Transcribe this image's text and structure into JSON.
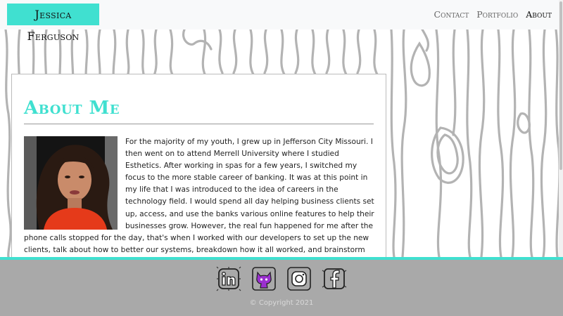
{
  "navbar": {
    "brand": "Jessica Ferguson",
    "links": [
      "Contact",
      "Portfolio",
      "About"
    ]
  },
  "about": {
    "title": "About Me",
    "photo_alt": "portrait of Jessica Ferguson",
    "bio": "For the majority of my youth, I grew up in Jefferson City Missouri. I then went on to attend Merrell University where I studied Esthetics. After working in spas for a few years, I switched my focus to the more stable career of banking. It was at this point in my life that I was introduced to the idea of careers in the technology field. I would spend all day helping business clients set up, access, and use the banks various online features to help their businesses grow. However, the real fun happened for me after the phone calls stopped for the day, that's when I worked with our developers to set up the new clients, talk about how to better our systems, breakdown how it all worked, and brainstorm how we would be on the cutting edge of banking technology."
  },
  "footer": {
    "social_icons": [
      "linkedin-icon",
      "github-icon",
      "instagram-icon",
      "facebook-icon"
    ],
    "copyright": "© Copyright 2021"
  },
  "colors": {
    "accent": "#40e0d0",
    "footer_bg": "#a9a9a9",
    "github_purple": "#9b30d0"
  }
}
